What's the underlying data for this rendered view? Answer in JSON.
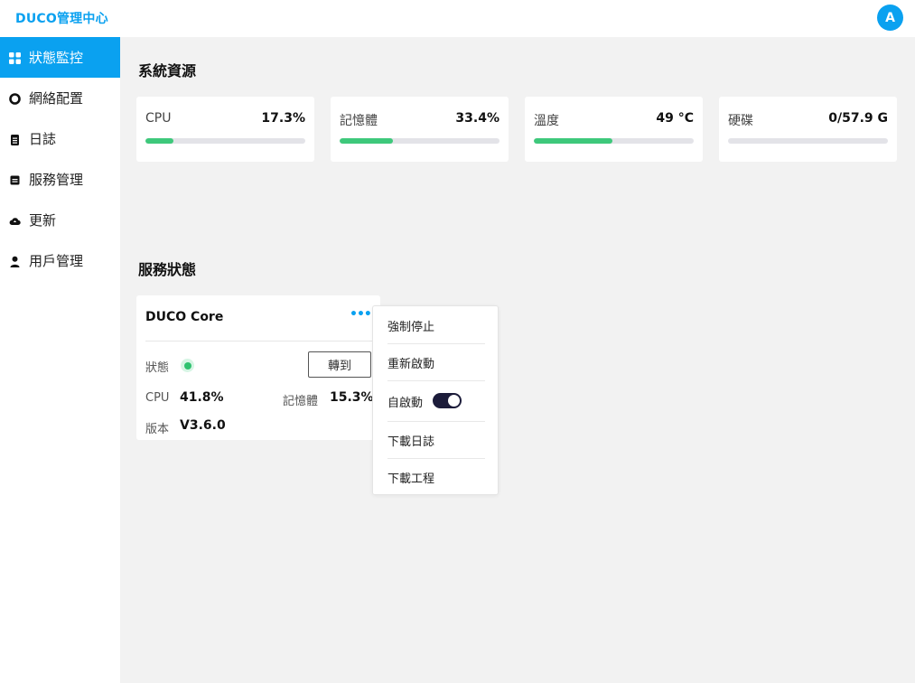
{
  "header": {
    "brand": "DUCO管理中心",
    "avatar_initial": "A",
    "accent_color": "#0aa1f0"
  },
  "sidebar": {
    "items": [
      {
        "label": "狀態監控",
        "icon": "grid-icon",
        "active": true
      },
      {
        "label": "網絡配置",
        "icon": "ring-icon",
        "active": false
      },
      {
        "label": "日誌",
        "icon": "clipboard-icon",
        "active": false
      },
      {
        "label": "服務管理",
        "icon": "document-icon",
        "active": false
      },
      {
        "label": "更新",
        "icon": "cloud-icon",
        "active": false
      },
      {
        "label": "用戶管理",
        "icon": "user-icon",
        "active": false
      }
    ]
  },
  "resources": {
    "title": "系統資源",
    "cards": [
      {
        "name": "CPU",
        "value": "17.3%",
        "progress": 0.173
      },
      {
        "name": "記憶體",
        "value": "33.4%",
        "progress": 0.334
      },
      {
        "name": "溫度",
        "value": "49 °C",
        "progress": 0.49
      },
      {
        "name": "硬碟",
        "value": "0/57.9 G",
        "progress": 0
      }
    ]
  },
  "services": {
    "title": "服務狀態",
    "card": {
      "name": "DUCO Core",
      "status_label": "狀態",
      "status_color": "#2fc26f",
      "goto_label": "轉到",
      "cpu_label": "CPU",
      "cpu_value": "41.8%",
      "mem_label": "記憶體",
      "mem_value": "15.3%",
      "version_label": "版本",
      "version_value": "V3.6.0"
    },
    "menu": {
      "force_stop": "強制停止",
      "restart": "重新啟動",
      "autostart": "自啟動",
      "autostart_on": true,
      "download_log": "下載日誌",
      "download_project": "下載工程"
    }
  }
}
